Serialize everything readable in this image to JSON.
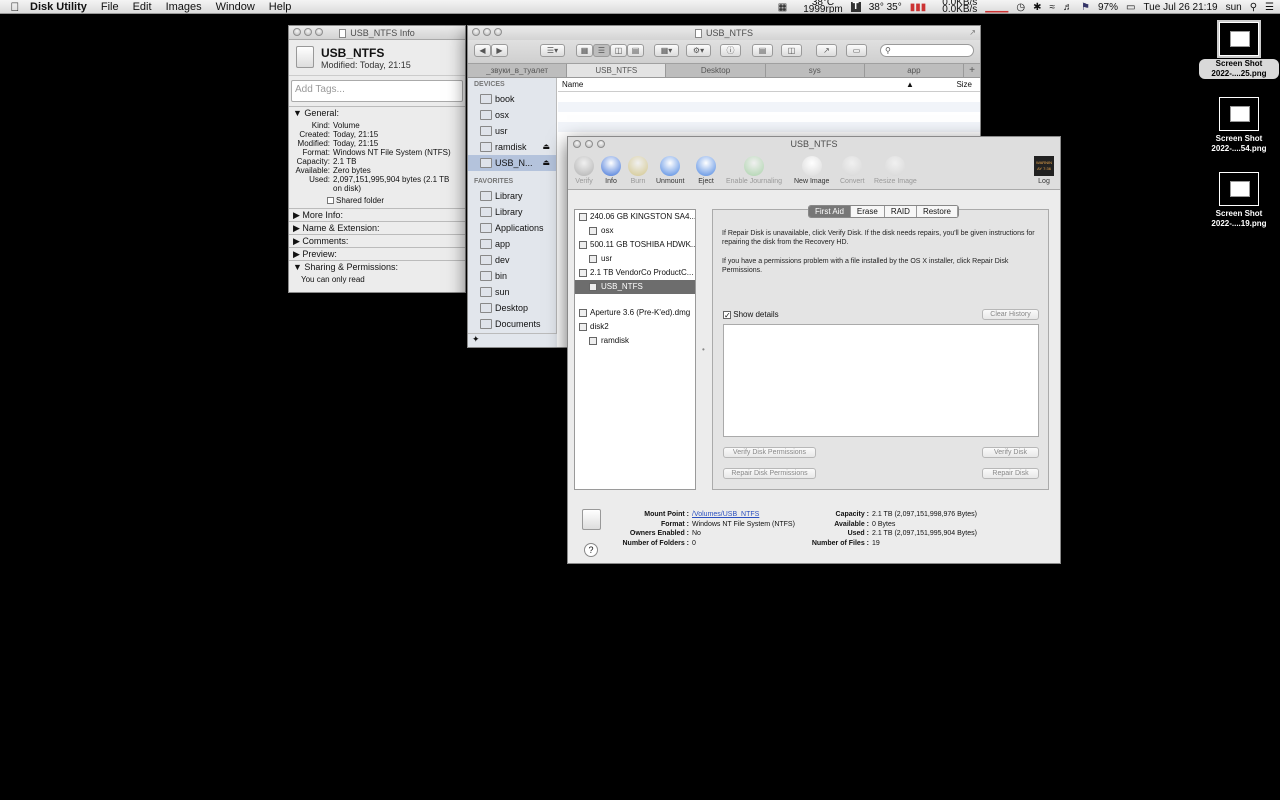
{
  "menubar": {
    "app_name": "Disk Utility",
    "items": [
      "File",
      "Edit",
      "Images",
      "Window",
      "Help"
    ],
    "cpu_temp": "38°C",
    "fan_rpm": "1999rpm",
    "temps": "38° 35°",
    "net_up": "0.0KB/s",
    "net_down": "0.0KB/s",
    "battery": "97%",
    "datetime": "Tue Jul 26  21:19",
    "user": "sun"
  },
  "info_window": {
    "title": "USB_NTFS Info",
    "name": "USB_NTFS",
    "modified": "Modified: Today, 21:15",
    "tags_placeholder": "Add Tags...",
    "general_label": "General:",
    "fields": [
      {
        "k": "Kind:",
        "v": "Volume"
      },
      {
        "k": "Created:",
        "v": "Today, 21:15"
      },
      {
        "k": "Modified:",
        "v": "Today, 21:15"
      },
      {
        "k": "Format:",
        "v": "Windows NT File System (NTFS)"
      },
      {
        "k": "Capacity:",
        "v": "2.1 TB"
      },
      {
        "k": "Available:",
        "v": "Zero bytes"
      },
      {
        "k": "Used:",
        "v": "2,097,151,995,904 bytes (2.1 TB on disk)"
      }
    ],
    "shared_folder": "Shared folder",
    "sections": [
      "More Info:",
      "Name & Extension:",
      "Comments:",
      "Preview:"
    ],
    "sharing_label": "Sharing & Permissions:",
    "sharing_text": "You can only read"
  },
  "finder": {
    "title": "USB_NTFS",
    "tabs": [
      "_звуки_в_туалет",
      "USB_NTFS",
      "Desktop",
      "sys",
      "app"
    ],
    "devices_label": "DEVICES",
    "devices": [
      "book",
      "osx",
      "usr",
      "ramdisk",
      "USB_N..."
    ],
    "favorites_label": "FAVORITES",
    "favorites": [
      "Library",
      "Library",
      "Applications",
      "app",
      "dev",
      "bin",
      "sun",
      "Desktop",
      "Documents"
    ],
    "col_name": "Name",
    "col_size": "Size"
  },
  "disk_utility": {
    "title": "USB_NTFS",
    "tools": [
      {
        "label": "Verify",
        "enabled": false,
        "color": "#8a8a8a"
      },
      {
        "label": "Info",
        "enabled": true,
        "color": "#3b6fd6"
      },
      {
        "label": "Burn",
        "enabled": false,
        "color": "#c9b24a"
      },
      {
        "label": "Unmount",
        "enabled": true,
        "color": "#4a84e0"
      },
      {
        "label": "Eject",
        "enabled": true,
        "color": "#4a84e0"
      },
      {
        "label": "Enable Journaling",
        "enabled": false,
        "color": "#7fc87f"
      },
      {
        "label": "New Image",
        "enabled": true,
        "color": "#d8d8d8"
      },
      {
        "label": "Convert",
        "enabled": false,
        "color": "#d0d0d0"
      },
      {
        "label": "Resize Image",
        "enabled": false,
        "color": "#d0d0d0"
      }
    ],
    "log_label": "Log",
    "log_icon_text": "WARNIN\nAY 7:36",
    "disks": [
      {
        "label": "240.06 GB KINGSTON SA4...",
        "level": 0
      },
      {
        "label": "osx",
        "level": 1
      },
      {
        "label": "500.11 GB TOSHIBA HDWK...",
        "level": 0
      },
      {
        "label": "usr",
        "level": 1
      },
      {
        "label": "2.1 TB VendorCo ProductC...",
        "level": 0
      },
      {
        "label": "USB_NTFS",
        "level": 1
      },
      {
        "label": "Aperture 3.6 (Pre-K'ed).dmg",
        "level": 0
      },
      {
        "label": "disk2",
        "level": 0
      },
      {
        "label": "ramdisk",
        "level": 1
      }
    ],
    "tabs": [
      "First Aid",
      "Erase",
      "RAID",
      "Restore"
    ],
    "text1": "If Repair Disk is unavailable, click Verify Disk. If the disk needs repairs, you'll be given instructions for repairing the disk from the Recovery HD.",
    "text2": "If you have a permissions problem with a file installed by the OS X installer, click Repair Disk Permissions.",
    "show_details": "Show details",
    "clear_history": "Clear History",
    "verify_perms": "Verify Disk Permissions",
    "verify_disk": "Verify Disk",
    "repair_perms": "Repair Disk Permissions",
    "repair_disk": "Repair Disk",
    "footer_left": [
      {
        "k": "Mount Point :",
        "v": "/Volumes/USB_NTFS"
      },
      {
        "k": "Format :",
        "v": "Windows NT File System (NTFS)"
      },
      {
        "k": "Owners Enabled :",
        "v": "No"
      },
      {
        "k": "Number of Folders :",
        "v": "0"
      }
    ],
    "footer_right": [
      {
        "k": "Capacity :",
        "v": "2.1 TB (2,097,151,998,976 Bytes)"
      },
      {
        "k": "Available :",
        "v": "0 Bytes"
      },
      {
        "k": "Used :",
        "v": "2.1 TB (2,097,151,995,904 Bytes)"
      },
      {
        "k": "Number of Files :",
        "v": "19"
      }
    ],
    "help": "?"
  },
  "desktop_icons": [
    {
      "line1": "Screen Shot",
      "line2": "2022-....25.png"
    },
    {
      "line1": "Screen Shot",
      "line2": "2022-....54.png"
    },
    {
      "line1": "Screen Shot",
      "line2": "2022-....19.png"
    }
  ]
}
